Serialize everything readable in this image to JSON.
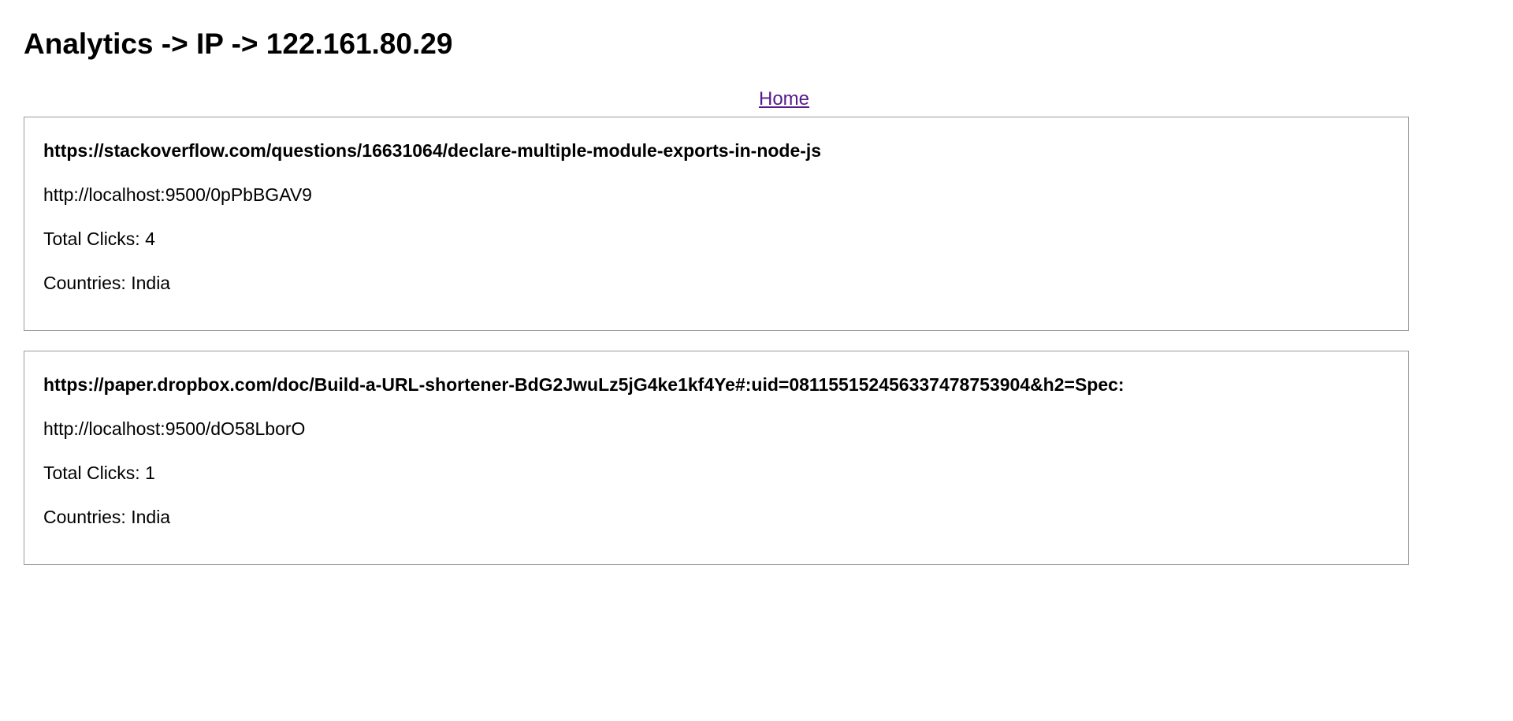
{
  "page": {
    "title": "Analytics -> IP -> 122.161.80.29"
  },
  "nav": {
    "home_label": "Home"
  },
  "links": [
    {
      "original_url": "https://stackoverflow.com/questions/16631064/declare-multiple-module-exports-in-node-js",
      "short_url": "http://localhost:9500/0pPbBGAV9",
      "total_clicks": "Total Clicks: 4",
      "countries": "Countries: India"
    },
    {
      "original_url": "https://paper.dropbox.com/doc/Build-a-URL-shortener-BdG2JwuLz5jG4ke1kf4Ye#:uid=081155152456337478753904&h2=Spec:",
      "short_url": "http://localhost:9500/dO58LborO",
      "total_clicks": "Total Clicks: 1",
      "countries": "Countries: India"
    }
  ],
  "colors": {
    "link_visited": "#551a8b",
    "card_border": "#9a9a9a",
    "text": "#000000",
    "background": "#ffffff"
  }
}
